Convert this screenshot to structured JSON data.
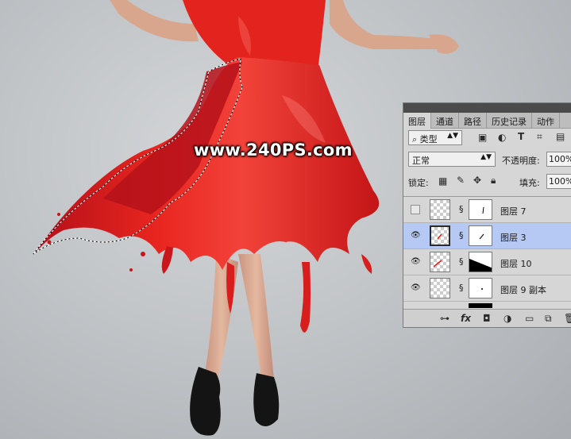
{
  "watermark": "www.240PS.com",
  "panel": {
    "tabs": [
      "图层",
      "通道",
      "路径",
      "历史记录",
      "动作"
    ],
    "active_tab": 0,
    "filter": {
      "label": "类型",
      "icon": "search-icon"
    },
    "blend_mode": "正常",
    "opacity_label": "不透明度:",
    "opacity_value": "100%",
    "lock_label": "锁定:",
    "fill_label": "填充:",
    "fill_value": "100%",
    "layers": [
      {
        "name": "图层 7",
        "visible": false,
        "selected": false
      },
      {
        "name": "图层 3",
        "visible": true,
        "selected": true
      },
      {
        "name": "图层 10",
        "visible": true,
        "selected": false
      },
      {
        "name": "图层 9 副本",
        "visible": true,
        "selected": false
      }
    ],
    "footer_icons": [
      "link-icon",
      "fx-icon",
      "mask-icon",
      "adjustment-icon",
      "folder-icon",
      "new-layer-icon",
      "trash-icon"
    ]
  },
  "colors": {
    "dress": "#e8201e",
    "dress_dark": "#a80e14",
    "skin": "#d9a98e",
    "selection_highlight": "#b5c9f4"
  }
}
